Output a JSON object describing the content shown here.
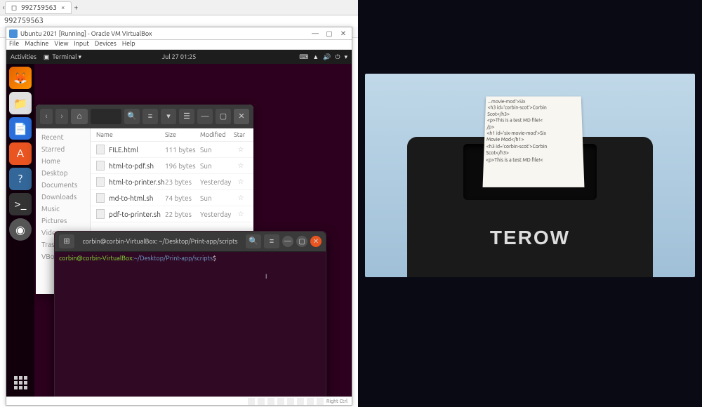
{
  "browser": {
    "tab_label": "992759563",
    "tab_close": "×",
    "plus": "+",
    "url": "992759563"
  },
  "vbox": {
    "title": "Ubuntu 2021 [Running] - Oracle VM VirtualBox",
    "menu": [
      "File",
      "Machine",
      "View",
      "Input",
      "Devices",
      "Help"
    ],
    "right_ctrl": "Right Ctrl"
  },
  "topbar": {
    "activities": "Activities",
    "app": "Terminal ▾",
    "clock": "Jul 27  01:25"
  },
  "sidebar": {
    "items": [
      {
        "label": "Recent"
      },
      {
        "label": "Starred"
      },
      {
        "label": "Home"
      },
      {
        "label": "Desktop"
      },
      {
        "label": "Documents"
      },
      {
        "label": "Downloads"
      },
      {
        "label": "Music"
      },
      {
        "label": "Pictures"
      },
      {
        "label": "Videos"
      },
      {
        "label": "Trash"
      },
      {
        "label": "VBox_G..."
      }
    ]
  },
  "files": {
    "columns": {
      "c1": "Name",
      "c2": "Size",
      "c3": "Modified",
      "c4": "Star"
    },
    "rows": [
      {
        "name": "FILE.html",
        "size": "111 bytes",
        "mod": "Sun",
        "star": "☆"
      },
      {
        "name": "html-to-pdf.sh",
        "size": "196 bytes",
        "mod": "Sun",
        "star": "☆"
      },
      {
        "name": "html-to-printer.sh",
        "size": "23 bytes",
        "mod": "Yesterday",
        "star": "☆"
      },
      {
        "name": "md-to-html.sh",
        "size": "74 bytes",
        "mod": "Sun",
        "star": "☆"
      },
      {
        "name": "pdf-to-printer.sh",
        "size": "22 bytes",
        "mod": "Yesterday",
        "star": "☆"
      }
    ]
  },
  "terminal": {
    "title": "corbin@corbin-VirtualBox: ~/Desktop/Print-app/scripts",
    "prompt_user": "corbin@corbin-VirtualBox",
    "prompt_path": ":~/Desktop/Print-app/scripts",
    "prompt_sym": "$"
  },
  "printer": {
    "brand": "TEROW",
    "paper_lines": [
      "...movie-mod'>Six",
      "<h3 id='corbin-scot'>Corbin",
      "Scot</h3>",
      "<p>This is a test MD file!<",
      "/p>",
      "",
      "<h1 id='six-movie-mod'>Six",
      "Movie Mod</h1>",
      "<h3 id='corbin-scot'>Corbin",
      "Scot</h3>",
      "<p>This is a test MD file!<"
    ]
  }
}
